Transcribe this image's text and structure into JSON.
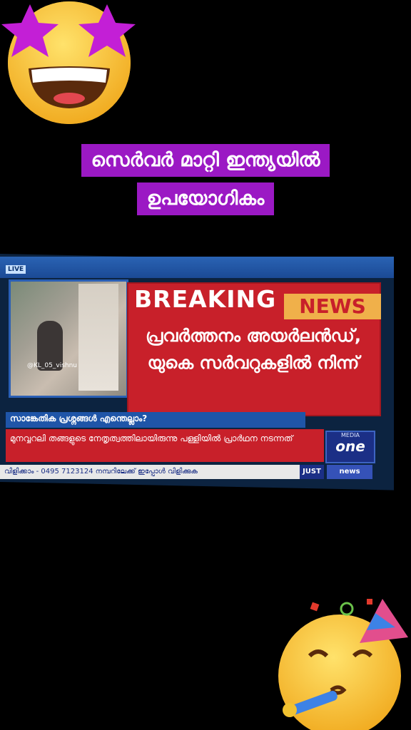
{
  "caption": {
    "line1": "സെർവർ മാറ്റി ഇന്ത്യയിൽ",
    "line2": "ഉപയോഗികം"
  },
  "tv": {
    "live_label": "LIVE",
    "watermark": "@KL_05_vishnu",
    "breaking_word": "BREAKING",
    "news_word": "NEWS",
    "headline": "പ്രവർത്തനം അയർലൻഡ്, യുകെ സർവറുകളിൽ നിന്ന്",
    "sub_heading": "സാങ്കേതിക പ്രശ്നങ്ങൾ എന്തെല്ലാം?",
    "ticker_text": "മുനവ്വറലി തങ്ങളുടെ നേതൃത്വത്തിലായിരുന്നു പള്ളിയിൽ പ്രാർഥന നടന്നത്",
    "bottom_ticker": "വിളിക്കാം - 0495 7123124 നമ്പറിലേക്ക് ഇപ്പോൾ വിളിക്കുക",
    "just_label": "JUST",
    "news_chip": "news",
    "logo_top": "MEDIA",
    "logo_main": "one"
  },
  "emojis": {
    "top_emoji": "star-struck-face-icon",
    "bottom_emoji": "partying-face-icon"
  }
}
